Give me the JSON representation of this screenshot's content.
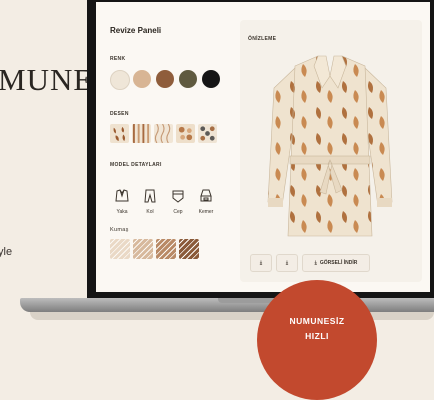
{
  "background": {
    "headline": "MUNE",
    "tagline": "yle"
  },
  "panel": {
    "title": "Revize Paneli",
    "color_section": "RENK",
    "colors": [
      "#efe6d8",
      "#d8b594",
      "#8f5d3b",
      "#5f5a3f",
      "#151515"
    ],
    "pattern_section": "DESEN",
    "details_section": "MODEL DETAYLARI",
    "details": [
      {
        "label": "Yaka",
        "icon": "collar-icon"
      },
      {
        "label": "Kol",
        "icon": "sleeve-icon"
      },
      {
        "label": "Cep",
        "icon": "pocket-icon"
      },
      {
        "label": "Kemer",
        "icon": "belt-icon"
      }
    ],
    "fabric_section": "Kumaş",
    "fabrics": [
      "#ead9c6",
      "#d7b99d",
      "#b98a66",
      "#8a5a39"
    ]
  },
  "preview": {
    "label": "ÖNİZLEME",
    "download_label": "GÖRSELİ İNDİR"
  },
  "badge": {
    "line1": "NUMUNESİZ",
    "line2": "HIZLI"
  }
}
